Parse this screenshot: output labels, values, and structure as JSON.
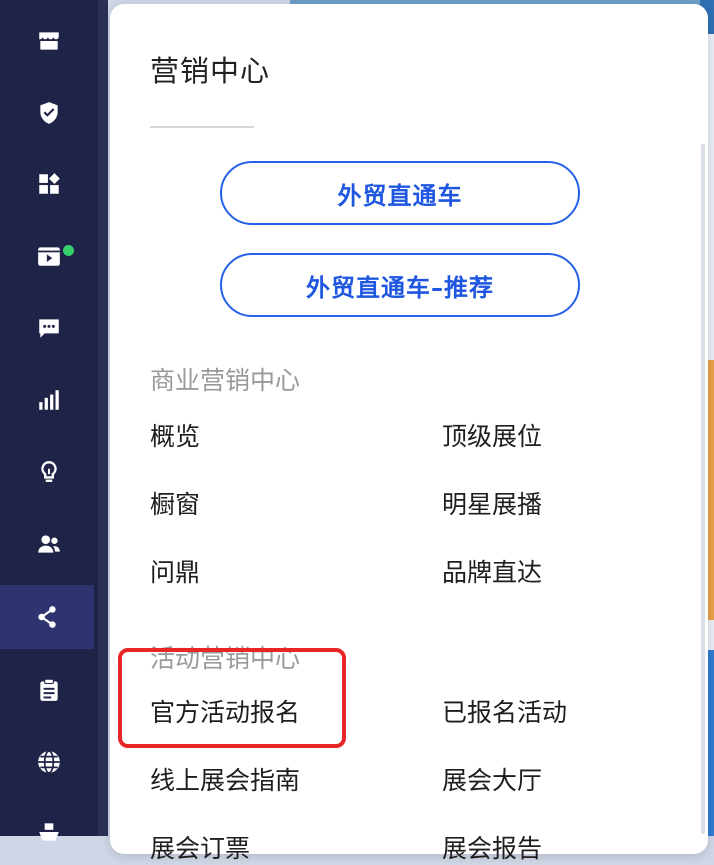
{
  "panel": {
    "title": "营销中心",
    "buttons": [
      {
        "label": "外贸直通车"
      },
      {
        "label": "外贸直通车–推荐"
      }
    ],
    "sections": [
      {
        "heading": "商业营销中心",
        "items": [
          "概览",
          "顶级展位",
          "橱窗",
          "明星展播",
          "问鼎",
          "品牌直达"
        ]
      },
      {
        "heading": "活动营销中心",
        "items": [
          "官方活动报名",
          "已报名活动",
          "线上展会指南",
          "展会大厅",
          "展会订票",
          "展会报告"
        ]
      }
    ]
  },
  "rail": {
    "icons": [
      "store-icon",
      "shield-check-icon",
      "apps-icon",
      "video-icon",
      "chat-icon",
      "bar-chart-icon",
      "lightbulb-icon",
      "users-icon",
      "share-nodes-icon",
      "clipboard-icon",
      "globe-icon",
      "ship-icon"
    ],
    "active": "share-nodes-icon",
    "badge_color": "#35d06b"
  },
  "colors": {
    "accent": "#2461e8",
    "highlight": "#e8262a",
    "rail_bg": "#1f2348"
  }
}
